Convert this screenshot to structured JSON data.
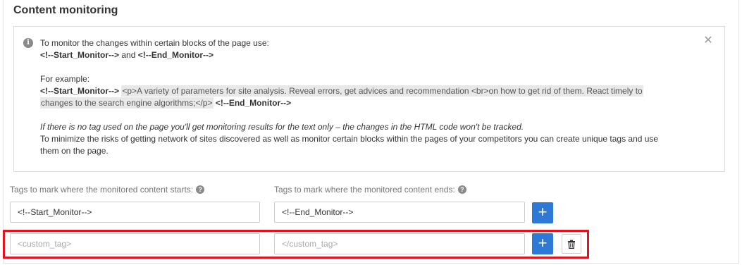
{
  "section": {
    "title": "Content monitoring"
  },
  "info": {
    "line1": "To monitor the changes within certain blocks of the page use:",
    "start_tag": "<!--Start_Monitor-->",
    "and_word": "and",
    "end_tag": "<!--End_Monitor-->",
    "example_label": "For example:",
    "example_start": "<!--Start_Monitor-->",
    "example_code_1": "<p>A variety of parameters for site analysis. Reveal errors, get advices and recommendation <br>on how to get rid of them. React timely to",
    "example_code_2": "changes to the search engine algorithms;</p>",
    "example_end": "<!--End_Monitor-->",
    "note_italic": "If there is no tag used on the page you'll get monitoring results for the text only – the changes in the HTML code won't be tracked.",
    "note_1": "To minimize the risks of getting network of sites discovered as well as monitor certain blocks within the pages of your competitors you can create unique tags and use",
    "note_2": "them on the page."
  },
  "fields": {
    "start_label": "Tags to mark where the monitored content starts:",
    "end_label": "Tags to mark where the monitored content ends:",
    "row1_start_value": "<!--Start_Monitor-->",
    "row1_end_value": "<!--End_Monitor-->",
    "row2_start_placeholder": "<custom_tag>",
    "row2_end_placeholder": "</custom_tag>",
    "add_glyph": "+",
    "help_glyph": "?"
  },
  "icons": {
    "info": "info-icon",
    "close": "close-icon",
    "help": "question-icon",
    "add": "plus-icon",
    "delete": "trash-icon"
  },
  "colors": {
    "accent": "#2f79d6",
    "highlight": "#e0141e"
  }
}
